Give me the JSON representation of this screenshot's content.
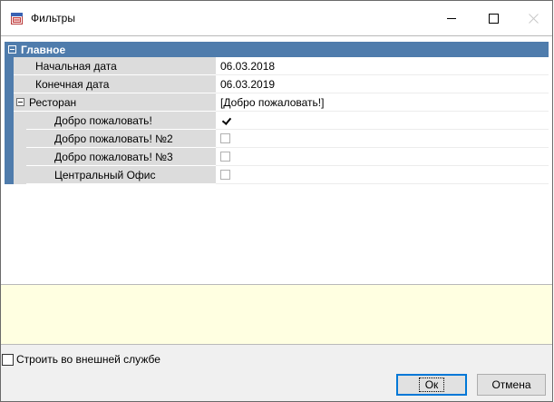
{
  "window": {
    "title": "Фильтры",
    "icon": "filter-form-icon",
    "controls": [
      "minimize",
      "maximize",
      "close"
    ]
  },
  "grid": {
    "section_title": "Главное",
    "rows": [
      {
        "label": "Начальная дата",
        "value": "06.03.2018"
      },
      {
        "label": "Конечная дата",
        "value": "06.03.2019"
      },
      {
        "label": "Ресторан",
        "value": "[Добро пожаловать!]",
        "expanded": true
      }
    ],
    "restaurants": [
      {
        "label": "Добро пожаловать!",
        "checked": true
      },
      {
        "label": "Добро пожаловать! №2",
        "checked": false
      },
      {
        "label": "Добро пожаловать! №3",
        "checked": false
      },
      {
        "label": "Центральный Офис",
        "checked": false
      }
    ]
  },
  "footer": {
    "external_service_label": "Строить во внешней службе",
    "external_service_checked": false,
    "ok_label": "Ок",
    "cancel_label": "Отмена"
  },
  "colors": {
    "section_header": "#4f7cac",
    "name_cell": "#dcdcdc",
    "description_panel": "#ffffe1",
    "default_button_border": "#0078d7"
  }
}
